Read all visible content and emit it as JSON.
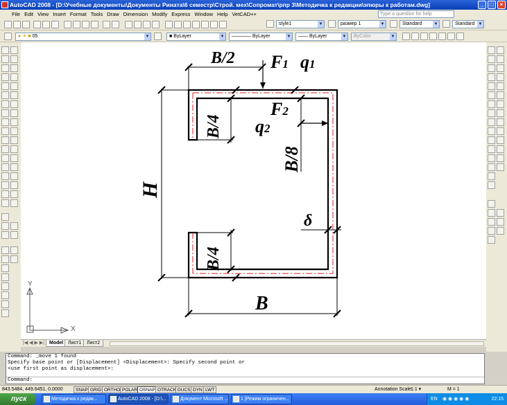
{
  "title": "AutoCAD 2008 - [D:\\Учебные документы\\Документы Рината\\6 семестр\\Строй. мех\\Сопромат\\рпр 3\\Методичка к редакции\\эпюры к работам.dwg]",
  "window_controls": {
    "min": "_",
    "max": "□",
    "close": "×"
  },
  "menu": [
    "File",
    "Edit",
    "View",
    "Insert",
    "Format",
    "Tools",
    "Draw",
    "Dimension",
    "Modify",
    "Express",
    "Window",
    "Help",
    "VetCAD++"
  ],
  "help_placeholder": "Type a question for help",
  "toolbar2": {
    "text_style": "style1",
    "dim_style": "размер 1",
    "table_style": "Standard",
    "multileader_style": "Standard"
  },
  "toolbar3": {
    "layer": "05",
    "color": "ByLayer",
    "linetype": "ByLayer",
    "lineweight": "ByLayer",
    "plotstyle": "ByColor"
  },
  "drawing": {
    "labels": {
      "b_half": "B/2",
      "f1": "F",
      "f1_sub": "1",
      "q1": "q",
      "q1_sub": "1",
      "b_quarter_top": "B/4",
      "f2": "F",
      "f2_sub": "2",
      "q2": "q",
      "q2_sub": "2",
      "b_eighth": "B/8",
      "h": "H",
      "delta": "δ",
      "b_quarter_bottom": "B/4",
      "b": "B"
    },
    "ucs": {
      "x": "X",
      "y": "Y"
    }
  },
  "tabs": {
    "model": "Model",
    "layout1": "Лист1",
    "layout2": "Лист2"
  },
  "command_history": [
    "Command: _move 1 found",
    "Specify base point or [Displacement] <Displacement>: Specify second point or",
    "<use first point as displacement>:"
  ],
  "command_prompt": "Command:",
  "status": {
    "coords": "843.5484, 449.6451, 0.0000",
    "toggles": [
      "SNAP",
      "GRID",
      "ORTHO",
      "POLAR",
      "OSNAP",
      "OTRACK",
      "DUCS",
      "DYN",
      "LWT"
    ],
    "annotation_scale_label": "Annotation Scale:",
    "annotation_scale_value": "1:1 ▾",
    "scale_m": "M = 1"
  },
  "taskbar": {
    "start": "пуск",
    "tasks": [
      "Методичка к редак...",
      "AutoCAD 2008 - [D:\\...",
      "Документ Microsoft ...",
      "1 [Режим ограничен..."
    ],
    "lang": "EN",
    "time": "22:15"
  }
}
